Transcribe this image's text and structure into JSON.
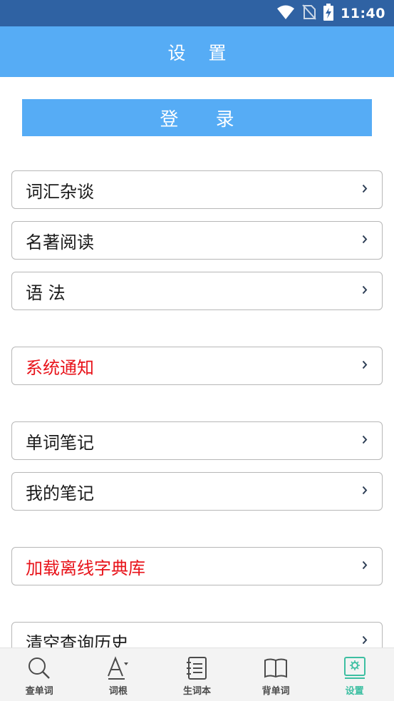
{
  "status_bar": {
    "time": "11:40",
    "icons": [
      "wifi-icon",
      "no-sim-icon",
      "battery-charging-icon"
    ]
  },
  "header": {
    "title": "设 置"
  },
  "login": {
    "label": "登 录"
  },
  "menu": {
    "vocab_chat": "词汇杂谈",
    "classics_reading": "名著阅读",
    "grammar": "语 法",
    "system_notice": "系统通知",
    "word_notes": "单词笔记",
    "my_notes": "我的笔记",
    "offline_dict": "加载离线字典库",
    "clear_history": "清空查询历史"
  },
  "colors": {
    "accent": "#56acf5",
    "status_bar": "#2f62a3",
    "alert_text": "#e8141b",
    "active_tab": "#3dbfa2"
  },
  "bottom_nav": {
    "lookup": "查单词",
    "roots": "词根",
    "wordbook": "生词本",
    "memorize": "背单词",
    "settings": "设置",
    "active": "设置"
  }
}
